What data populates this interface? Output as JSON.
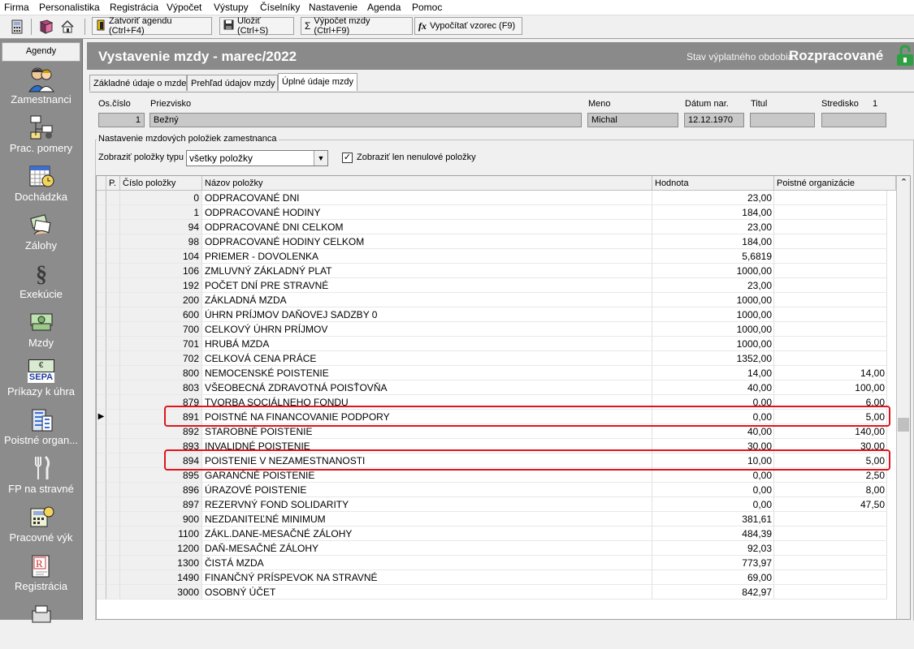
{
  "menu": [
    "Firma",
    "Personalistika",
    "Registrácia",
    "Výpočet",
    "Výstupy",
    "Číselníky",
    "Nastavenie",
    "Agenda",
    "Pomoc"
  ],
  "toolbar": {
    "close_agenda": "Zatvoriť agendu (Ctrl+F4)",
    "save": "Uložiť (Ctrl+S)",
    "calc_wage": "Výpočet mzdy (Ctrl+F9)",
    "calc_formula": "Vypočítať vzorec (F9)",
    "sigma_glyph": "Σ",
    "fx_glyph": "fx"
  },
  "sidebar": {
    "header": "Agendy",
    "items": [
      {
        "label": "Zamestnanci",
        "icon": "people-icon"
      },
      {
        "label": "Prac. pomery",
        "icon": "org-chart-icon"
      },
      {
        "label": "Dochádzka",
        "icon": "calendar-clock-icon"
      },
      {
        "label": "Zálohy",
        "icon": "cards-icon"
      },
      {
        "label": "Exekúcie",
        "icon": "paragraph-icon"
      },
      {
        "label": "Mzdy",
        "icon": "money-icon"
      },
      {
        "label": "Príkazy k úhra",
        "icon": "sepa-icon",
        "badge": "SEPA",
        "currency": "€"
      },
      {
        "label": "Poistné organ...",
        "icon": "building-icon"
      },
      {
        "label": "FP na stravné",
        "icon": "cutlery-icon"
      },
      {
        "label": "Pracovné výk",
        "icon": "calculator-icon"
      },
      {
        "label": "Registrácia",
        "icon": "registration-icon",
        "badge": "R"
      }
    ]
  },
  "header": {
    "title": "Vystavenie mzdy -  marec/2022",
    "status_label": "Stav výplatného obdobia:",
    "status_value": "Rozpracované"
  },
  "tabs": [
    "Základné údaje o mzde",
    "Prehľad údajov mzdy",
    "Úplné údaje mzdy"
  ],
  "employee": {
    "labels": {
      "os_cislo": "Os.číslo",
      "priezvisko": "Priezvisko",
      "meno": "Meno",
      "datum": "Dátum nar.",
      "titul": "Titul",
      "stredisko": "Stredisko"
    },
    "os_cislo": "1",
    "priezvisko": "Bežný",
    "meno": "Michal",
    "datum": "12.12.1970",
    "titul": "",
    "stredisko": "",
    "stredisko_number": "1"
  },
  "settings": {
    "group_label": "Nastavenie mzdových položiek zamestnanca",
    "type_label": "Zobraziť položky typu",
    "type_value": "všetky položky",
    "nonzero_label": "Zobraziť len nenulové položky",
    "nonzero_checked": "✓"
  },
  "grid": {
    "headers": [
      "P.",
      "Číslo položky",
      "Názov položky",
      "Hodnota",
      "Poistné organizácie"
    ],
    "current_row_marker": "▶",
    "rows": [
      {
        "num": "0",
        "name": "ODPRACOVANÉ DNI",
        "value": "23,00",
        "org": ""
      },
      {
        "num": "1",
        "name": "ODPRACOVANÉ HODINY",
        "value": "184,00",
        "org": ""
      },
      {
        "num": "94",
        "name": "ODPRACOVANÉ DNI CELKOM",
        "value": "23,00",
        "org": ""
      },
      {
        "num": "98",
        "name": "ODPRACOVANÉ HODINY CELKOM",
        "value": "184,00",
        "org": ""
      },
      {
        "num": "104",
        "name": "PRIEMER - DOVOLENKA",
        "value": "5,6819",
        "org": ""
      },
      {
        "num": "106",
        "name": "ZMLUVNÝ ZÁKLADNÝ PLAT",
        "value": "1000,00",
        "org": ""
      },
      {
        "num": "192",
        "name": "POČET DNÍ PRE STRAVNÉ",
        "value": "23,00",
        "org": ""
      },
      {
        "num": "200",
        "name": "ZÁKLADNÁ MZDA",
        "value": "1000,00",
        "org": ""
      },
      {
        "num": "600",
        "name": "ÚHRN PRÍJMOV DAŇOVEJ SADZBY 0",
        "value": "1000,00",
        "org": ""
      },
      {
        "num": "700",
        "name": "CELKOVÝ ÚHRN PRÍJMOV",
        "value": "1000,00",
        "org": ""
      },
      {
        "num": "701",
        "name": "HRUBÁ MZDA",
        "value": "1000,00",
        "org": ""
      },
      {
        "num": "702",
        "name": "CELKOVÁ CENA PRÁCE",
        "value": "1352,00",
        "org": ""
      },
      {
        "num": "800",
        "name": "NEMOCENSKÉ POISTENIE",
        "value": "14,00",
        "org": "14,00"
      },
      {
        "num": "803",
        "name": "VŠEOBECNÁ ZDRAVOTNÁ POISŤOVŇA",
        "value": "40,00",
        "org": "100,00"
      },
      {
        "num": "879",
        "name": "TVORBA SOCIÁLNEHO FONDU",
        "value": "0,00",
        "org": "6,00"
      },
      {
        "num": "891",
        "name": "POISTNÉ NA FINANCOVANIE PODPORY",
        "value": "0,00",
        "org": "5,00",
        "current": true
      },
      {
        "num": "892",
        "name": "STAROBNÉ POISTENIE",
        "value": "40,00",
        "org": "140,00"
      },
      {
        "num": "893",
        "name": "INVALIDNÉ POISTENIE",
        "value": "30,00",
        "org": "30,00"
      },
      {
        "num": "894",
        "name": "POISTENIE V NEZAMESTNANOSTI",
        "value": "10,00",
        "org": "5,00"
      },
      {
        "num": "895",
        "name": "GARANČNÉ POISTENIE",
        "value": "0,00",
        "org": "2,50"
      },
      {
        "num": "896",
        "name": "ÚRAZOVÉ POISTENIE",
        "value": "0,00",
        "org": "8,00"
      },
      {
        "num": "897",
        "name": "REZERVNÝ FOND SOLIDARITY",
        "value": "0,00",
        "org": "47,50"
      },
      {
        "num": "900",
        "name": "NEZDANITEĽNÉ MINIMUM",
        "value": "381,61",
        "org": ""
      },
      {
        "num": "1100",
        "name": "ZÁKL.DANE-MESAČNÉ ZÁLOHY",
        "value": "484,39",
        "org": ""
      },
      {
        "num": "1200",
        "name": "DAŇ-MESAČNÉ ZÁLOHY",
        "value": "92,03",
        "org": ""
      },
      {
        "num": "1300",
        "name": "ČISTÁ MZDA",
        "value": "773,97",
        "org": ""
      },
      {
        "num": "1490",
        "name": "FINANČNÝ PRÍSPEVOK NA STRAVNÉ",
        "value": "69,00",
        "org": ""
      },
      {
        "num": "3000",
        "name": "OSOBNÝ ÚČET",
        "value": "842,97",
        "org": ""
      }
    ],
    "scroll_up_glyph": "⌃"
  },
  "colors": {
    "highlight": "#e0141e",
    "sidebar": "#8c8c8c",
    "title_bar": "#8a8a8a",
    "lock": "#2ea043"
  }
}
